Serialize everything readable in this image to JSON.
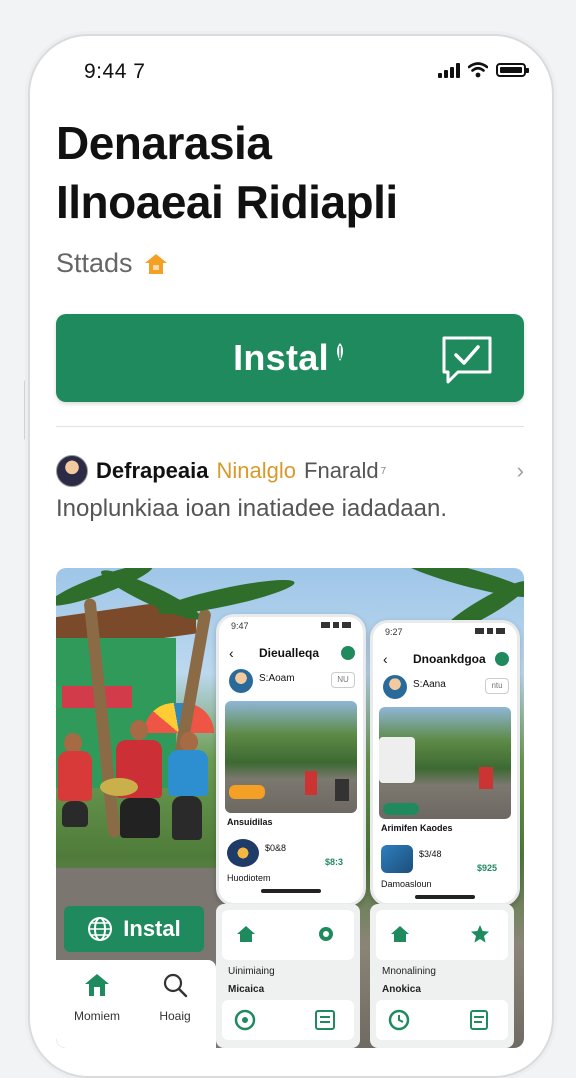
{
  "status_bar": {
    "time": "9:44 7"
  },
  "app": {
    "title_line1": "Denarasia",
    "title_line2": "Ilnoaeai Ridiapli",
    "stats_label": "Sttads",
    "install_label": "Instal",
    "brand_color": "#1f8a5d"
  },
  "developer": {
    "name": "Defrapeaia",
    "category": "Ninalglo",
    "extra": "Fnarald",
    "superscript": "7",
    "chevron": "›"
  },
  "description": "Inoplunkiaa ioan inatiadee iadadaan.",
  "gallery": {
    "install_label": "Instal",
    "nav": [
      {
        "icon": "home-icon",
        "label": "Momiem"
      },
      {
        "icon": "search-icon",
        "label": "Hoaig"
      }
    ],
    "screens": [
      {
        "time": "9:47",
        "title": "Dieualleqa",
        "user": "S:Aoam",
        "tag": "NU",
        "caption": "Ansuidilas",
        "price_label": "$0&8",
        "price": "$8:3",
        "footer": "Huodiotem",
        "tray_label1": "Uinimiaing",
        "tray_label2": "Micaica"
      },
      {
        "time": "9:27",
        "title": "Dnoankdgoa",
        "user": "S:Aana",
        "tag": "ntu",
        "caption": "Arimifen Kaodes",
        "price_label": "$3/48",
        "price": "$925",
        "footer": "Damoasloun",
        "tray_label1": "Mnonalining",
        "tray_label2": "Anokica"
      }
    ]
  }
}
